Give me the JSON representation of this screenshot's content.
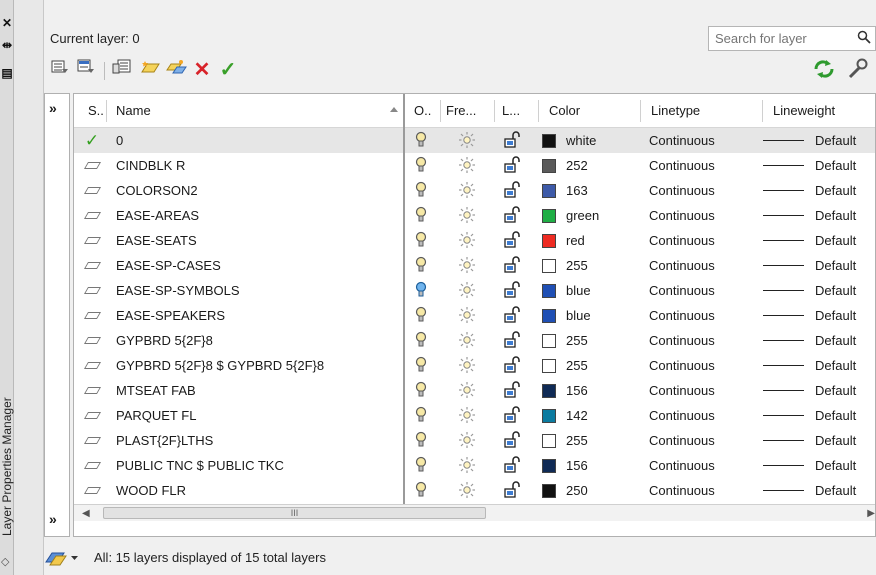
{
  "panel": {
    "title": "Layer Properties Manager"
  },
  "header": {
    "current_layer": "Current layer: 0"
  },
  "search": {
    "placeholder": "Search for layer"
  },
  "columns": [
    "S..",
    "Name",
    "O..",
    "Fre...",
    "L...",
    "Color",
    "Linetype",
    "Lineweight"
  ],
  "rows": [
    {
      "name": "0",
      "status": "current",
      "on": true,
      "freeze": "thawed",
      "lock": "unlocked",
      "color_value": "white",
      "color_hex": "#111111",
      "linetype": "Continuous",
      "lineweight": "Default",
      "selected": true
    },
    {
      "name": "CINDBLK R",
      "status": "layer",
      "on": true,
      "color_value": "252",
      "color_hex": "#5a5a5a",
      "linetype": "Continuous",
      "lineweight": "Default"
    },
    {
      "name": "COLORSON2",
      "status": "layer",
      "on": true,
      "color_value": "163",
      "color_hex": "#3d5aa8",
      "linetype": "Continuous",
      "lineweight": "Default"
    },
    {
      "name": "EASE-AREAS",
      "status": "layer",
      "on": true,
      "color_value": "green",
      "color_hex": "#1fae45",
      "linetype": "Continuous",
      "lineweight": "Default"
    },
    {
      "name": "EASE-SEATS",
      "status": "layer",
      "on": true,
      "color_value": "red",
      "color_hex": "#ee2b22",
      "linetype": "Continuous",
      "lineweight": "Default"
    },
    {
      "name": "EASE-SP-CASES",
      "status": "layer",
      "on": true,
      "color_value": "255",
      "color_hex": "#ffffff",
      "linetype": "Continuous",
      "lineweight": "Default"
    },
    {
      "name": "EASE-SP-SYMBOLS",
      "status": "layer",
      "on": true,
      "bulb_blue": true,
      "color_value": "blue",
      "color_hex": "#1f4fb4",
      "linetype": "Continuous",
      "lineweight": "Default"
    },
    {
      "name": "EASE-SPEAKERS",
      "status": "layer",
      "on": true,
      "color_value": "blue",
      "color_hex": "#1f4fb4",
      "linetype": "Continuous",
      "lineweight": "Default"
    },
    {
      "name": "GYPBRD 5{2F}8",
      "status": "layer",
      "on": true,
      "color_value": "255",
      "color_hex": "#ffffff",
      "linetype": "Continuous",
      "lineweight": "Default"
    },
    {
      "name": "GYPBRD 5{2F}8 $ GYPBRD 5{2F}8",
      "status": "layer",
      "on": true,
      "color_value": "255",
      "color_hex": "#ffffff",
      "linetype": "Continuous",
      "lineweight": "Default"
    },
    {
      "name": "MTSEAT FAB",
      "status": "layer",
      "on": true,
      "color_value": "156",
      "color_hex": "#0f2a55",
      "linetype": "Continuous",
      "lineweight": "Default"
    },
    {
      "name": "PARQUET FL",
      "status": "layer",
      "on": true,
      "color_value": "142",
      "color_hex": "#0b7ba0",
      "linetype": "Continuous",
      "lineweight": "Default"
    },
    {
      "name": "PLAST{2F}LTHS",
      "status": "layer",
      "on": true,
      "color_value": "255",
      "color_hex": "#ffffff",
      "linetype": "Continuous",
      "lineweight": "Default"
    },
    {
      "name": "PUBLIC TNC $ PUBLIC TKC",
      "status": "layer",
      "on": true,
      "color_value": "156",
      "color_hex": "#0f2a55",
      "linetype": "Continuous",
      "lineweight": "Default"
    },
    {
      "name": "WOOD FLR",
      "status": "layer",
      "on": true,
      "color_value": "250",
      "color_hex": "#111111",
      "linetype": "Continuous",
      "lineweight": "Default"
    }
  ],
  "status_bar": {
    "text": "All: 15 layers displayed of 15 total layers"
  },
  "scrollbar": {
    "thumb_grip": "III"
  },
  "icons": [
    "close-icon",
    "auto-hide-icon",
    "properties-icon",
    "new-property-filter-icon",
    "new-group-filter-icon",
    "layer-states-manager-icon",
    "new-layer-icon",
    "new-layer-vp-frozen-icon",
    "delete-layer-icon",
    "set-current-icon",
    "refresh-icon",
    "settings-icon",
    "search-icon",
    "expand-icon",
    "filter-icon"
  ]
}
